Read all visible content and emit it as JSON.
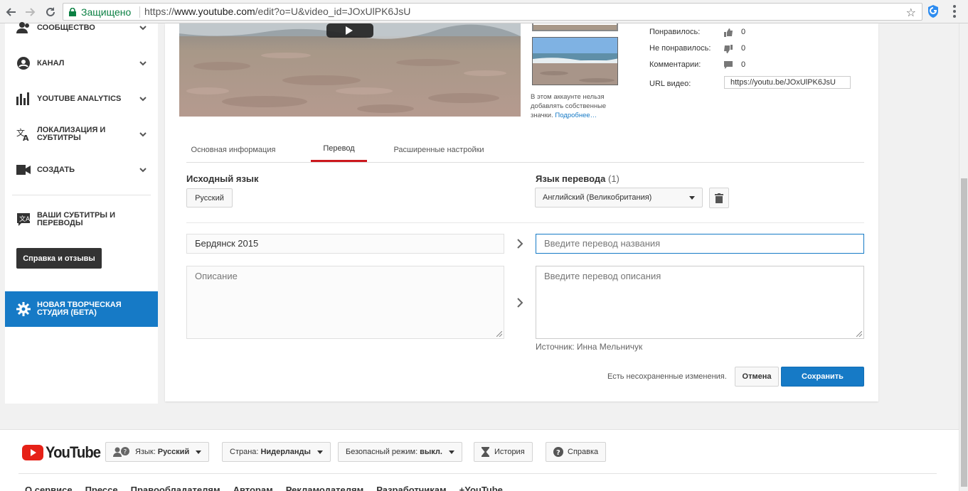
{
  "browser": {
    "secure_label": "Защищено",
    "url_scheme": "https://",
    "url_host": "www.youtube.com",
    "url_path": "/edit?o=U&video_id=JOxUlPK6JsU"
  },
  "sidebar": {
    "items": [
      {
        "label": "СООБЩЕСТВО",
        "icon": "community-icon"
      },
      {
        "label": "КАНАЛ",
        "icon": "channel-icon"
      },
      {
        "label": "YOUTUBE ANALYTICS",
        "icon": "analytics-icon"
      },
      {
        "label": "ЛОКАЛИЗАЦИЯ И СУБТИТРЫ",
        "icon": "translate-icon"
      },
      {
        "label": "СОЗДАТЬ",
        "icon": "camera-icon"
      }
    ],
    "subtitles_label": "ВАШИ СУБТИТРЫ И ПЕРЕВОДЫ",
    "help_button": "Справка и отзывы",
    "new_studio": "НОВАЯ ТВОРЧЕСКАЯ СТУДИЯ (БЕТА)",
    "accent_color": "#167ac6"
  },
  "video_info": {
    "thumbnail_note": "В этом аккаунте нельзя добавлять собственные значки.",
    "thumbnail_link": "Подробнее…",
    "stats": [
      {
        "label": "Понравилось:",
        "value": "0",
        "icon": "thumbs-up-icon"
      },
      {
        "label": "Не понравилось:",
        "value": "0",
        "icon": "thumbs-down-icon"
      },
      {
        "label": "Комментарии:",
        "value": "0",
        "icon": "comment-icon"
      }
    ],
    "url_label": "URL видео:",
    "url_value": "https://youtu.be/JOxUlPK6JsU"
  },
  "tabs": [
    {
      "label": "Основная информация",
      "active": false
    },
    {
      "label": "Перевод",
      "active": true
    },
    {
      "label": "Расширенные настройки",
      "active": false
    }
  ],
  "translation": {
    "source_heading": "Исходный язык",
    "source_language": "Русский",
    "target_heading": "Язык перевода",
    "target_count": "(1)",
    "target_language": "Английский (Великобритания)",
    "original_title": "Бердянск 2015",
    "original_description_placeholder": "Описание",
    "title_placeholder": "Введите перевод названия",
    "description_placeholder": "Введите перевод описания",
    "source_credit": "Источник: Инна Мельничук",
    "unsaved_text": "Есть несохраненные изменения.",
    "cancel_button": "Отмена",
    "save_button": "Сохранить"
  },
  "footer": {
    "logo_text": "YouTube",
    "language_label": "Язык:",
    "language_value": "Русский",
    "country_label": "Страна:",
    "country_value": "Нидерланды",
    "safety_label": "Безопасный режим:",
    "safety_value": "выкл.",
    "history_button": "История",
    "help_button": "Справка",
    "links": [
      "О сервисе",
      "Прессе",
      "Правообладателям",
      "Авторам",
      "Рекламодателям",
      "Разработчикам",
      "+YouTube"
    ]
  }
}
